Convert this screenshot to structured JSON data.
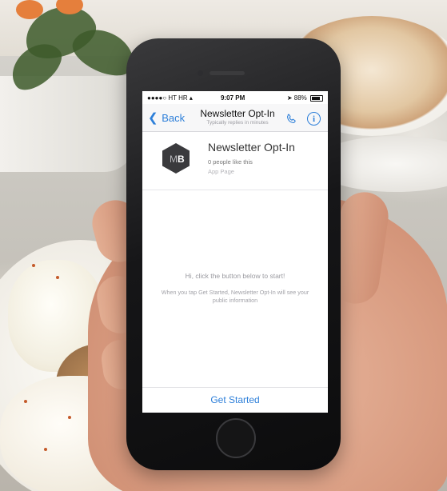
{
  "status_bar": {
    "carrier": "●●●●○ HT HR",
    "time": "9:07 PM",
    "battery": "88%"
  },
  "nav": {
    "back_label": "Back",
    "title": "Newsletter Opt-In",
    "subtitle": "Typically replies in minutes",
    "call_icon": "phone-icon",
    "info_icon": "info-icon"
  },
  "page": {
    "logo_text": "MB",
    "name": "Newsletter Opt-In",
    "likes": "0 people like this",
    "type": "App Page"
  },
  "conversation": {
    "welcome": "Hi, click the button below to start!",
    "notice": "When you tap Get Started, Newsletter Opt-In will see your public information"
  },
  "cta": {
    "label": "Get Started"
  },
  "colors": {
    "accent": "#2d7fd9",
    "logo_bg": "#3a3a3d"
  }
}
